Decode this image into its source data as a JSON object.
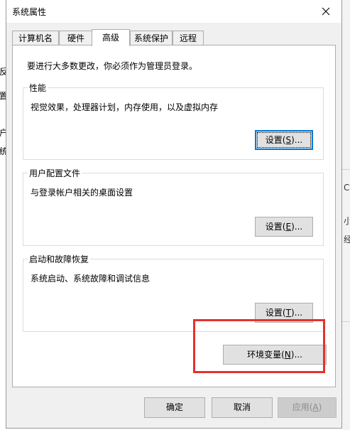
{
  "background": {
    "left_fragments": [
      "反",
      "置",
      "户",
      "统"
    ],
    "right_fragments": [
      "C",
      "小",
      "经"
    ]
  },
  "dialog": {
    "title": "系统属性",
    "close_glyph": "✕"
  },
  "tabs": [
    {
      "label": "计算机名",
      "active": false
    },
    {
      "label": "硬件",
      "active": false
    },
    {
      "label": "高级",
      "active": true
    },
    {
      "label": "系统保护",
      "active": false
    },
    {
      "label": "远程",
      "active": false
    }
  ],
  "page": {
    "notice": "要进行大多数更改，你必须作为管理员登录。",
    "performance": {
      "title": "性能",
      "description": "视觉效果，处理器计划，内存使用，以及虚拟内存",
      "button_prefix": "设置(",
      "button_mnemonic": "S",
      "button_suffix": ")..."
    },
    "user_profiles": {
      "title": "用户配置文件",
      "description": "与登录帐户相关的桌面设置",
      "button_prefix": "设置(",
      "button_mnemonic": "E",
      "button_suffix": ")..."
    },
    "startup_recovery": {
      "title": "启动和故障恢复",
      "description": "系统启动、系统故障和调试信息",
      "button_prefix": "设置(",
      "button_mnemonic": "T",
      "button_suffix": ")..."
    },
    "env_vars": {
      "button_prefix": "环境变量(",
      "button_mnemonic": "N",
      "button_suffix": ")..."
    }
  },
  "footer": {
    "ok_label": "确定",
    "cancel_label": "取消",
    "apply_prefix": "应用(",
    "apply_mnemonic": "A",
    "apply_suffix": ")"
  },
  "colors": {
    "highlight": "#e5322d",
    "focus": "#0078d7"
  }
}
